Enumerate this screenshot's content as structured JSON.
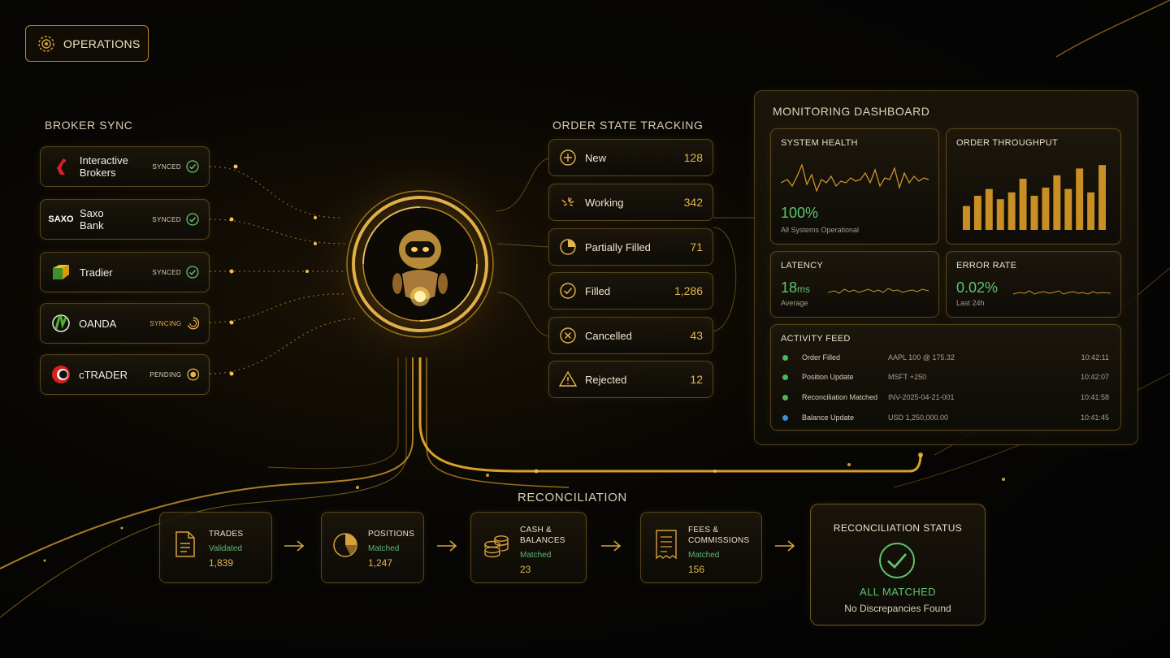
{
  "ops": {
    "label": "OPERATIONS"
  },
  "broker_sync": {
    "title": "BROKER SYNC",
    "brokers": [
      {
        "name": "Interactive Brokers",
        "status": "SYNCED",
        "logo": "interactive-brokers-logo"
      },
      {
        "name": "Saxo Bank",
        "logo_text": "SAXO",
        "status": "SYNCED"
      },
      {
        "name": "Tradier",
        "status": "SYNCED",
        "logo": "tradier-logo"
      },
      {
        "name": "OANDA",
        "status": "SYNCING",
        "logo": "oanda-logo"
      },
      {
        "name": "cTRADER",
        "status": "PENDING",
        "logo": "ctrader-logo"
      }
    ]
  },
  "order_state": {
    "title": "ORDER STATE TRACKING",
    "states": [
      {
        "label": "New",
        "count": "128",
        "icon": "plus-circle-icon"
      },
      {
        "label": "Working",
        "count": "342",
        "icon": "working-icon"
      },
      {
        "label": "Partially Filled",
        "count": "71",
        "icon": "partial-pie-icon"
      },
      {
        "label": "Filled",
        "count": "1,286",
        "icon": "check-circle-icon"
      },
      {
        "label": "Cancelled",
        "count": "43",
        "icon": "x-circle-icon"
      },
      {
        "label": "Rejected",
        "count": "12",
        "icon": "warning-triangle-icon"
      }
    ]
  },
  "monitoring": {
    "title": "MONITORING DASHBOARD",
    "system_health": {
      "title": "SYSTEM HEALTH",
      "value": "100%",
      "sub": "All Systems Operational"
    },
    "order_throughput": {
      "title": "ORDER THROUGHPUT",
      "bars": [
        0.35,
        0.5,
        0.6,
        0.45,
        0.55,
        0.75,
        0.5,
        0.62,
        0.8,
        0.6,
        0.9,
        0.55,
        0.95
      ]
    },
    "latency": {
      "title": "LATENCY",
      "value": "18",
      "unit": "ms",
      "sub": "Average"
    },
    "error_rate": {
      "title": "ERROR RATE",
      "value": "0.02%",
      "sub": "Last 24h"
    },
    "activity_feed": {
      "title": "ACTIVITY FEED",
      "items": [
        {
          "event": "Order Filled",
          "detail": "AAPL 100 @ 175.32",
          "time": "10:42:11",
          "color": "#4cb85c"
        },
        {
          "event": "Position Update",
          "detail": "MSFT +250",
          "time": "10:42:07",
          "color": "#4cb85c"
        },
        {
          "event": "Reconciliation Matched",
          "detail": "INV-2025-04-21-001",
          "time": "10:41:58",
          "color": "#4cb85c"
        },
        {
          "event": "Balance Update",
          "detail": "USD 1,250,000.00",
          "time": "10:41:45",
          "color": "#3d8fe0"
        }
      ]
    }
  },
  "reconciliation": {
    "title": "RECONCILIATION",
    "steps": [
      {
        "name": "TRADES",
        "status": "Validated",
        "value": "1,839",
        "icon": "document-icon"
      },
      {
        "name": "POSITIONS",
        "status": "Matched",
        "value": "1,247",
        "icon": "pie-chart-icon"
      },
      {
        "name": "CASH & BALANCES",
        "status": "Matched",
        "value": "23",
        "icon": "coins-icon"
      },
      {
        "name": "FEES & COMMISSIONS",
        "status": "Matched",
        "value": "156",
        "icon": "receipt-icon"
      }
    ],
    "status": {
      "title": "RECONCILIATION STATUS",
      "result": "ALL MATCHED",
      "sub": "No Discrepancies Found"
    }
  },
  "colors": {
    "gold": "#e5b44a",
    "green": "#5fc46e",
    "blue": "#3d8fe0"
  }
}
